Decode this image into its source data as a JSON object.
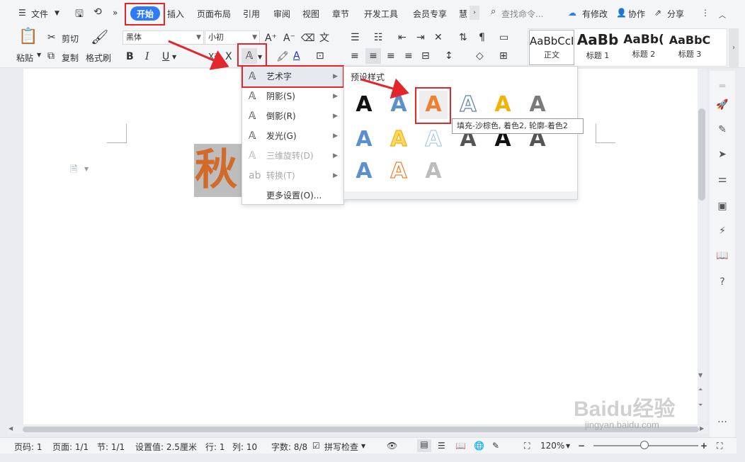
{
  "tabs": {
    "file": "文件",
    "items": [
      "开始",
      "插入",
      "页面布局",
      "引用",
      "审阅",
      "视图",
      "章节",
      "开发工具",
      "会员专享",
      "慧"
    ],
    "search_placeholder": "查找命令...",
    "has_changes": "有修改",
    "collaborate": "协作",
    "share": "分享"
  },
  "ribbon": {
    "paste": "粘贴",
    "cut": "剪切",
    "copy": "复制",
    "format_painter": "格式刷",
    "font_name": "黑体",
    "font_size": "小初",
    "bold": "B",
    "italic": "I",
    "underline": "U",
    "superscript": "X²",
    "styles": [
      {
        "preview": "AaBbCcI",
        "caption": "正文"
      },
      {
        "preview": "AaBb",
        "caption": "标题 1"
      },
      {
        "preview": "AaBb(",
        "caption": "标题 2"
      },
      {
        "preview": "AaBbC",
        "caption": "标题 3"
      }
    ]
  },
  "document": {
    "text": "秋"
  },
  "menu": {
    "items": [
      {
        "label": "艺术字",
        "icon": "art-text-icon"
      },
      {
        "label": "阴影(S)",
        "icon": "shadow-icon"
      },
      {
        "label": "倒影(R)",
        "icon": "reflection-icon"
      },
      {
        "label": "发光(G)",
        "icon": "glow-icon"
      },
      {
        "label": "三维旋转(D)",
        "icon": "3d-rotation-icon"
      },
      {
        "label": "转换(T)",
        "icon": "transform-icon"
      },
      {
        "label": "更多设置(O)...",
        "icon": ""
      }
    ]
  },
  "preset_panel": {
    "title": "预设样式",
    "glyph": "A",
    "colors": {
      "black": "#111111",
      "blue": "#5b8fd0",
      "orange": "#f07f2e",
      "outline_blue": "#5b7fb8",
      "gold": "#f2b400",
      "gray": "#7a7a7a",
      "light_blue": "#a8cdea",
      "light_gold": "#f8d86a",
      "dark_gray": "#555555",
      "silver": "#bcbcbc"
    },
    "tooltip": "填充-沙棕色, 着色2, 轮廓-着色2"
  },
  "statusbar": {
    "page_num": "页码: 1",
    "pages": "页面: 1/1",
    "section": "节: 1/1",
    "setting": "设置值: 2.5厘米",
    "row": "行: 1",
    "col": "列: 10",
    "chars": "字数: 8/8",
    "spellcheck": "拼写检查",
    "zoom": "120%",
    "watermark": "Baidu经验",
    "watermark_url": "jingyan.baidu.com"
  }
}
